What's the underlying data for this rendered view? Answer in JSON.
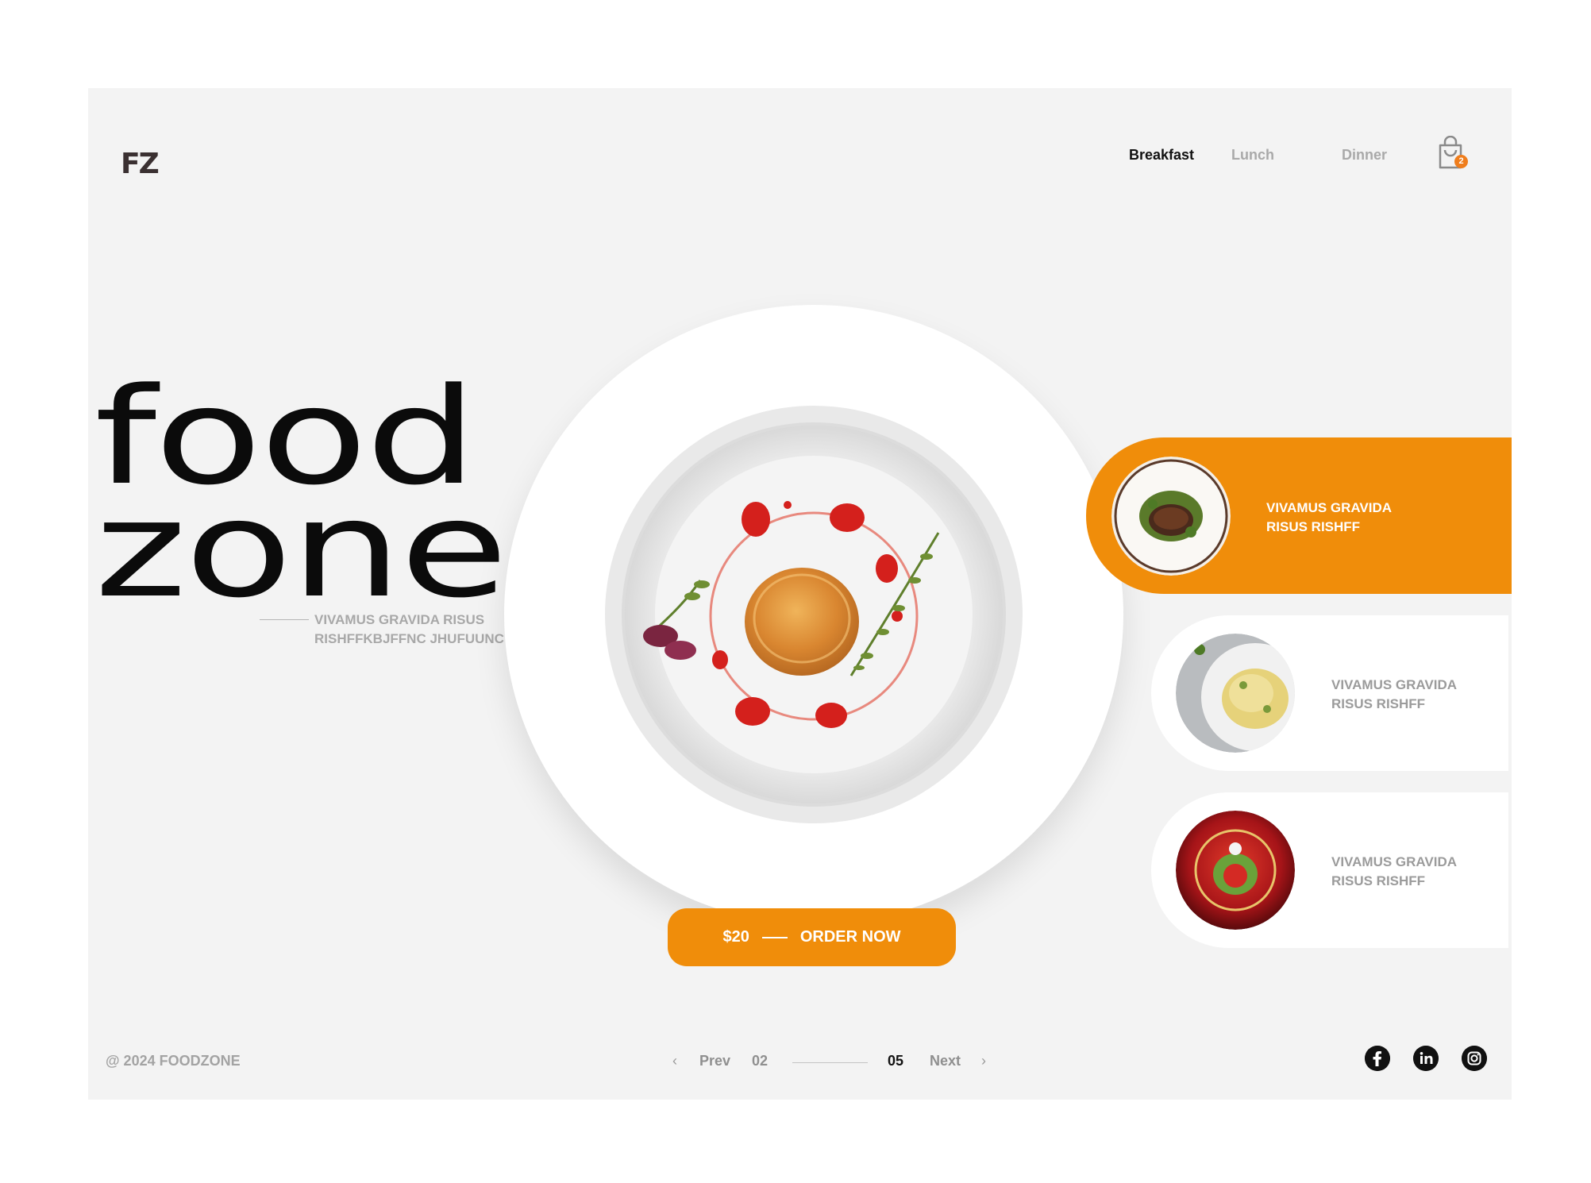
{
  "brand": {
    "logo": "FZ"
  },
  "nav": {
    "items": [
      {
        "label": "Breakfast",
        "active": true
      },
      {
        "label": "Lunch",
        "active": false
      },
      {
        "label": "Dinner",
        "active": false
      }
    ],
    "cart_count": "2",
    "cart_icon": "shopping-bag-icon"
  },
  "hero": {
    "title_line1": "food",
    "title_line2": "zone",
    "tagline_line1": "VIVAMUS GRAVIDA RISUS",
    "tagline_line2": "RISHFFKBJFFNC JHUFUUNC"
  },
  "order": {
    "price": "$20",
    "label": "ORDER NOW"
  },
  "menu_cards": [
    {
      "line1": "VIVAMUS GRAVIDA",
      "line2": "RISUS RISHFF",
      "selected": true
    },
    {
      "line1": "VIVAMUS GRAVIDA",
      "line2": "RISUS RISHFF",
      "selected": false
    },
    {
      "line1": "VIVAMUS GRAVIDA",
      "line2": "RISUS RISHFF",
      "selected": false
    }
  ],
  "footer": {
    "copyright": "@ 2024 FOODZONE",
    "pagination": {
      "prev": "Prev",
      "current": "02",
      "total": "05",
      "next": "Next",
      "progress": 0.4
    },
    "social": [
      "facebook-icon",
      "linkedin-icon",
      "instagram-icon"
    ]
  },
  "colors": {
    "accent": "#f08d0a",
    "background": "#f3f3f3",
    "text": "#0b0b0b",
    "muted": "#a8a8a8"
  }
}
